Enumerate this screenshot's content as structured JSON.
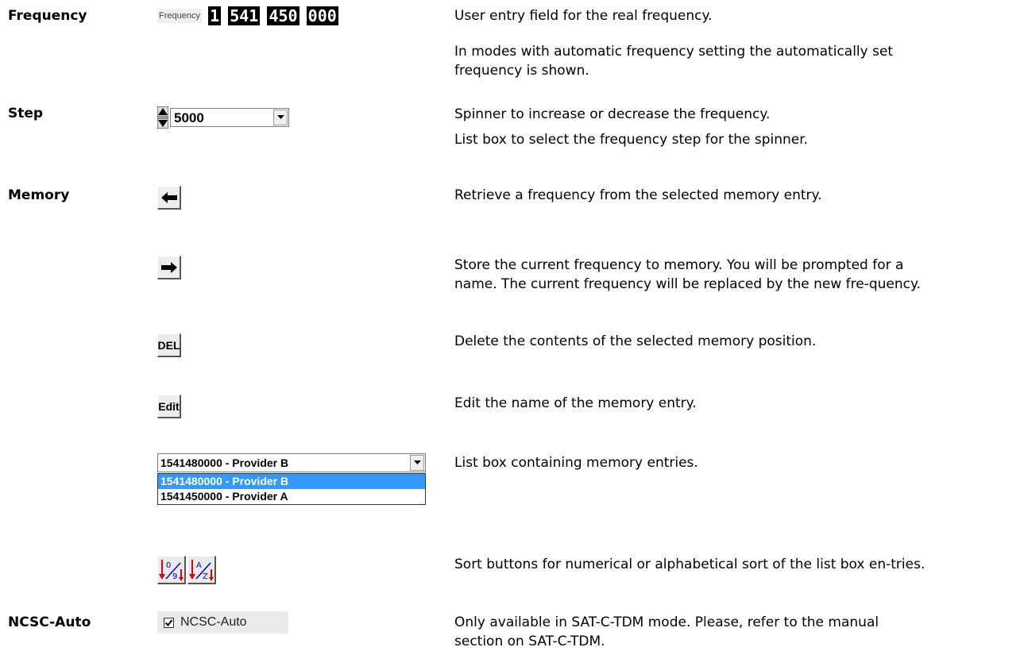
{
  "rows": {
    "frequency": {
      "term": "Frequency",
      "widget_label": "Frequency",
      "digits": [
        "1",
        "541",
        "450",
        "000"
      ],
      "desc1": "User entry field for the real frequency.",
      "desc2": "In modes with automatic frequency setting the automatically set frequency is shown."
    },
    "step": {
      "term": "Step",
      "value": "5000",
      "desc1": "Spinner to increase or decrease the frequency.",
      "desc2": "List box to select the frequency step for the spinner."
    },
    "memory": {
      "term": "Memory",
      "retrieve_desc": "Retrieve a frequency from the selected memory entry.",
      "store_desc": "Store the current frequency to memory. You will be prompted for a name. The current frequency will be replaced by the new fre-quency.",
      "del_label": "DEL",
      "del_desc": "Delete the contents of the selected memory position.",
      "edit_label": "Edit",
      "edit_desc": "Edit the name of the memory entry.",
      "combo_value": "1541480000 - Provider B",
      "options": [
        "1541480000 - Provider B",
        "1541450000 - Provider A"
      ],
      "list_desc": "List box containing memory entries.",
      "sort_desc": "Sort buttons for numerical or alphabetical sort of the list box en-tries."
    },
    "ncsc": {
      "term": "NCSC-Auto",
      "checkbox_label": "NCSC-Auto",
      "checked": true,
      "desc": "Only available in SAT-C-TDM mode. Please, refer to the manual section on SAT-C-TDM."
    }
  },
  "colors": {
    "selection": "#3399ff",
    "digit_bg": "#000000",
    "button_face": "#ececec"
  }
}
